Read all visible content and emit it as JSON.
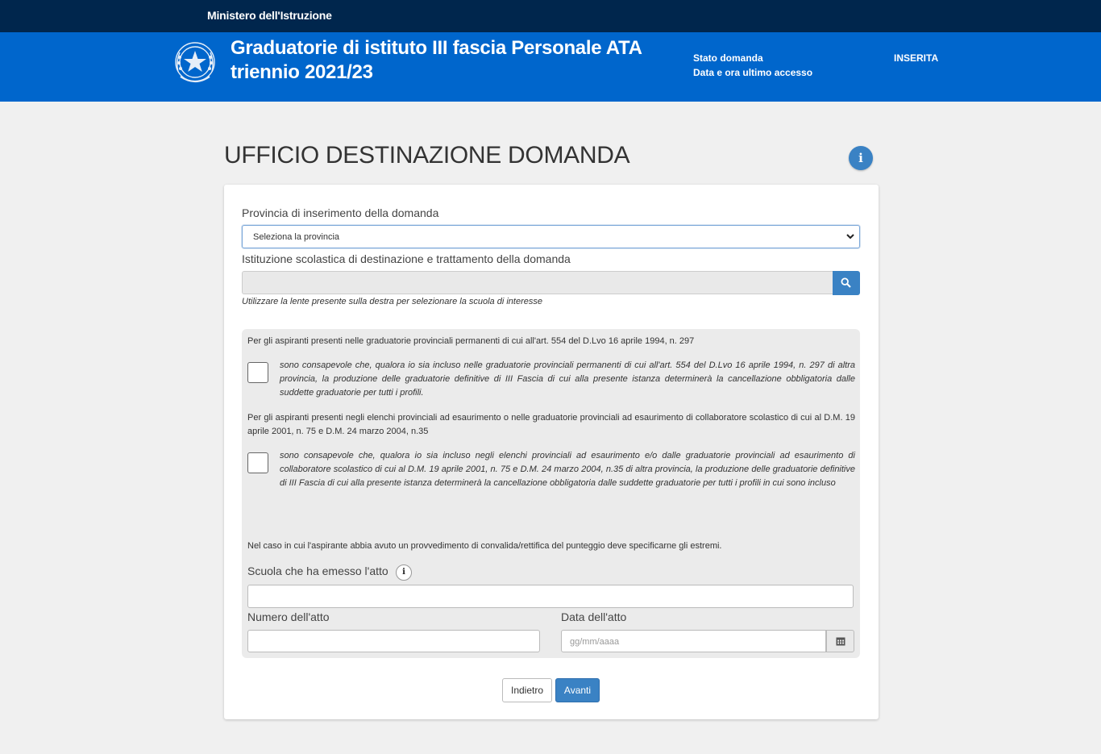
{
  "topbar": {
    "ministry": "Ministero dell'Istruzione"
  },
  "header": {
    "title_line1": "Graduatorie di istituto III fascia Personale ATA",
    "title_line2": "triennio 2021/23",
    "status_label": "Stato domanda",
    "last_access_label": "Data e ora ultimo accesso",
    "status_value": "INSERITA"
  },
  "page": {
    "title": "UFFICIO DESTINAZIONE DOMANDA"
  },
  "form": {
    "provincia_label": "Provincia di inserimento della domanda",
    "provincia_selected": "Seleziona la provincia",
    "istituzione_label": "Istituzione scolastica di destinazione e trattamento della domanda",
    "istituzione_hint": "Utilizzare la lente presente sulla destra per selezionare la scuola di interesse"
  },
  "panel": {
    "section1_text": "Per gli aspiranti presenti nelle graduatorie provinciali permanenti di cui all'art. 554 del D.Lvo 16 aprile 1994, n. 297",
    "check1_text": "sono consapevole che, qualora io sia incluso nelle graduatorie provinciali permanenti di cui all'art. 554 del D.Lvo 16 aprile 1994, n. 297 di altra provincia, la produzione delle graduatorie definitive di III Fascia di cui alla presente istanza determinerà la cancellazione obbligatoria dalle suddette graduatorie per tutti i profili.",
    "section2_text": "Per gli aspiranti presenti negli elenchi provinciali ad esaurimento o nelle graduatorie provinciali ad esaurimento di collaboratore scolastico di cui al D.M. 19 aprile 2001, n. 75 e D.M. 24 marzo 2004, n.35",
    "check2_text": "sono consapevole che, qualora io sia incluso negli elenchi provinciali ad esaurimento e/o dalle graduatorie provinciali ad esaurimento di collaboratore scolastico di cui al D.M. 19 aprile 2001, n. 75 e D.M. 24 marzo 2004, n.35 di altra provincia, la produzione delle graduatorie definitive di III Fascia di cui alla presente istanza determinerà la cancellazione obbligatoria dalle suddette graduatorie per tutti i profili in cui sono incluso",
    "convalida_text": "Nel caso in cui l'aspirante abbia avuto un provvedimento di convalida/rettifica del punteggio deve specificarne gli estremi.",
    "scuola_label": "Scuola che ha emesso l'atto",
    "numero_label": "Numero dell'atto",
    "data_label": "Data dell'atto",
    "data_placeholder": "gg/mm/aaaa"
  },
  "actions": {
    "back": "Indietro",
    "next": "Avanti"
  },
  "icons": {
    "emblem": "repubblica-emblem-icon",
    "info": "info-icon",
    "search": "search-icon",
    "calendar": "calendar-icon",
    "chevron": "chevron-down-icon"
  },
  "colors": {
    "navy": "#00264d",
    "brand_blue": "#0066cc",
    "button_blue": "#3a82c4"
  }
}
